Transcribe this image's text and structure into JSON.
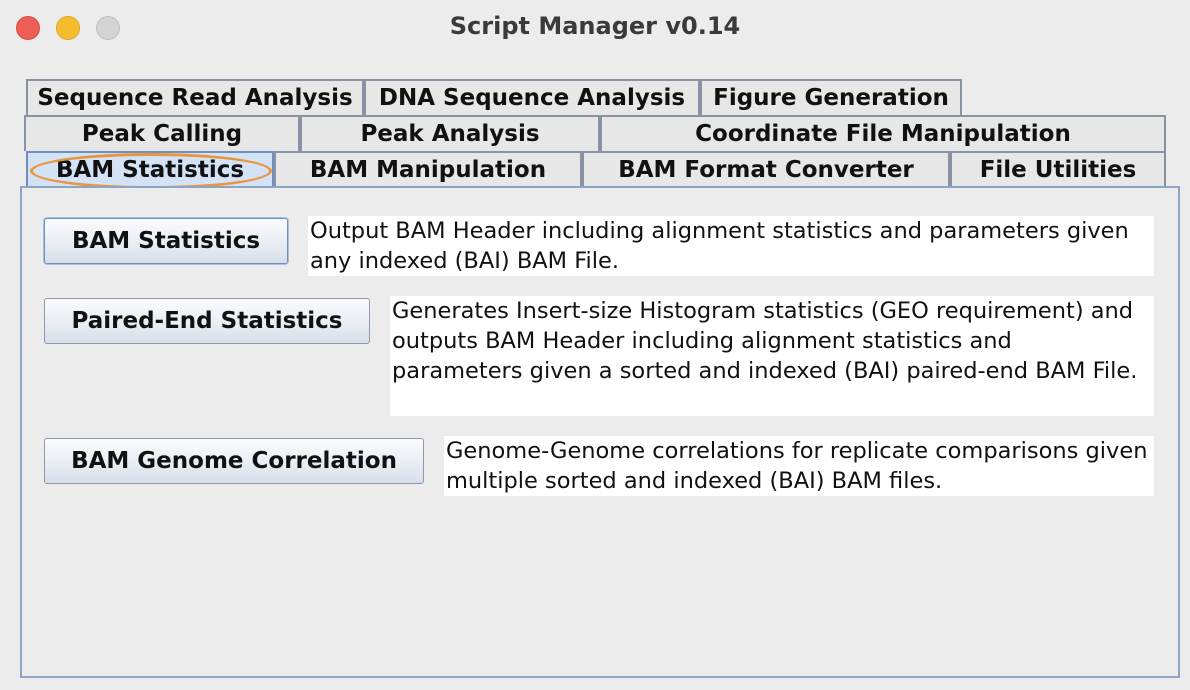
{
  "window": {
    "title": "Script Manager v0.14"
  },
  "tabs": {
    "row1": [
      "Sequence Read Analysis",
      "DNA Sequence Analysis",
      "Figure Generation"
    ],
    "row2": [
      "Peak Calling",
      "Peak Analysis",
      "Coordinate File Manipulation"
    ],
    "row3": [
      "BAM Statistics",
      "BAM Manipulation",
      "BAM Format Converter",
      "File Utilities"
    ],
    "selected": "BAM Statistics"
  },
  "tools": [
    {
      "button": "BAM Statistics",
      "description": "Output BAM Header including alignment statistics and parameters given any indexed (BAI) BAM File."
    },
    {
      "button": "Paired-End Statistics",
      "description": "Generates Insert-size Histogram statistics (GEO requirement) and outputs BAM Header including alignment statistics and parameters given a sorted and indexed (BAI) paired-end BAM File."
    },
    {
      "button": "BAM Genome Correlation",
      "description": "Genome-Genome correlations for replicate comparisons given multiple sorted and indexed (BAI) BAM files."
    }
  ],
  "colors": {
    "highlight_ring": "#e8953c",
    "selected_tab": "#d3e2f5"
  }
}
